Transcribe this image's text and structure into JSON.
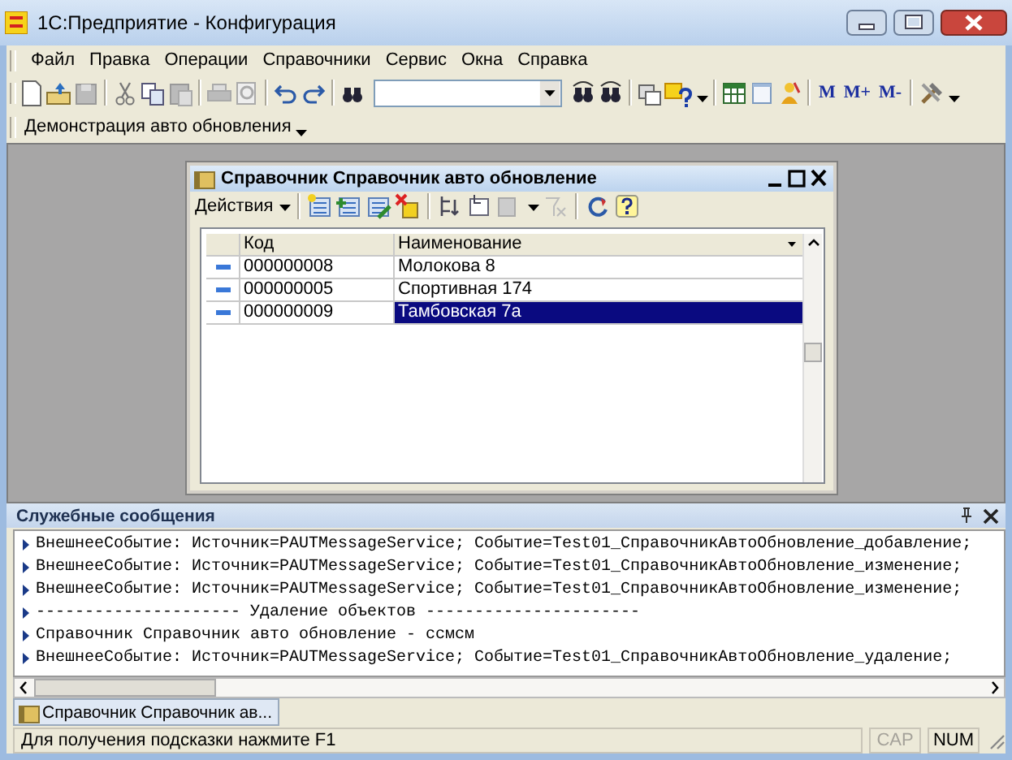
{
  "window": {
    "title": "1С:Предприятие - Конфигурация"
  },
  "menu": [
    {
      "label": "Файл"
    },
    {
      "label": "Правка"
    },
    {
      "label": "Операции"
    },
    {
      "label": "Справочники"
    },
    {
      "label": "Сервис"
    },
    {
      "label": "Окна"
    },
    {
      "label": "Справка"
    }
  ],
  "toolbar": {
    "memory_buttons": [
      "M",
      "M+",
      "M-"
    ]
  },
  "toolbar2": {
    "label": "Демонстрация авто обновления"
  },
  "child_window": {
    "title": "Справочник Справочник авто обновление",
    "actions_label": "Действия",
    "table": {
      "columns": [
        "Код",
        "Наименование"
      ],
      "rows": [
        {
          "code": "000000008",
          "name": "Молокова 8",
          "selected": false
        },
        {
          "code": "000000005",
          "name": "Спортивная 174",
          "selected": false
        },
        {
          "code": "000000009",
          "name": "Тамбовская 7а",
          "selected": true
        }
      ]
    }
  },
  "messages": {
    "title": "Служебные сообщения",
    "lines": [
      "ВнешнееСобытие: Источник=PAUTMessageService; Событие=Test01_СправочникАвтоОбновление_добавление;",
      "ВнешнееСобытие: Источник=PAUTMessageService; Событие=Test01_СправочникАвтоОбновление_изменение;",
      "ВнешнееСобытие: Источник=PAUTMessageService; Событие=Test01_СправочникАвтоОбновление_изменение;",
      "--------------------- Удаление объектов ----------------------",
      "Справочник Справочник авто обновление - ссмсм",
      "ВнешнееСобытие: Источник=PAUTMessageService; Событие=Test01_СправочникАвтоОбновление_удаление;"
    ]
  },
  "taskbar": [
    {
      "label": "Справочник Справочник ав...",
      "selected": true
    }
  ],
  "status_bar": {
    "text": "Для получения подсказки нажмите F1",
    "indicators": [
      {
        "label": "CAP",
        "on": false
      },
      {
        "label": "NUM",
        "on": true
      }
    ]
  }
}
